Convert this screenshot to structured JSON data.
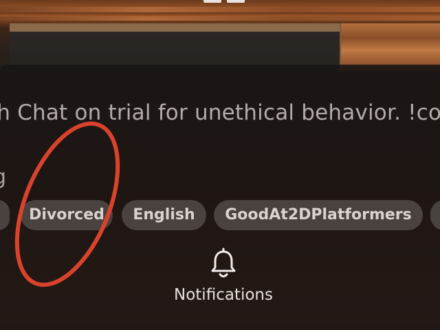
{
  "description": "ch Chat on trial for unethical behavior. !co",
  "sub_text": "g",
  "tags": [
    {
      "label": ""
    },
    {
      "label": "Divorced"
    },
    {
      "label": "English"
    },
    {
      "label": "GoodAt2DPlatformers"
    },
    {
      "label": ""
    }
  ],
  "notifications": {
    "label": "Notifications",
    "icon": "bell-icon"
  },
  "annotation": {
    "shape": "ellipse",
    "color": "#d9432b",
    "target": "Divorced"
  },
  "colors": {
    "overlay": "#231915",
    "tag_bg": "#4a423f",
    "tag_text": "#d9d3d0",
    "text_muted": "#b4acaa"
  }
}
